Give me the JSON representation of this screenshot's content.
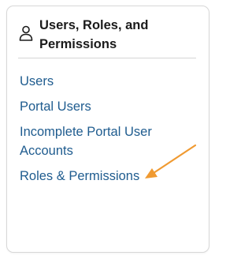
{
  "panel": {
    "title": "Users, Roles, and Permissions",
    "icon": "person-icon",
    "links": [
      {
        "label": "Users"
      },
      {
        "label": "Portal Users"
      },
      {
        "label": "Incomplete Portal User Accounts"
      },
      {
        "label": "Roles & Permissions"
      }
    ]
  },
  "colors": {
    "link": "#1f5c8f",
    "arrow": "#f09a31",
    "border": "#d7d7d7"
  },
  "annotation": {
    "icon": "arrow-icon"
  }
}
